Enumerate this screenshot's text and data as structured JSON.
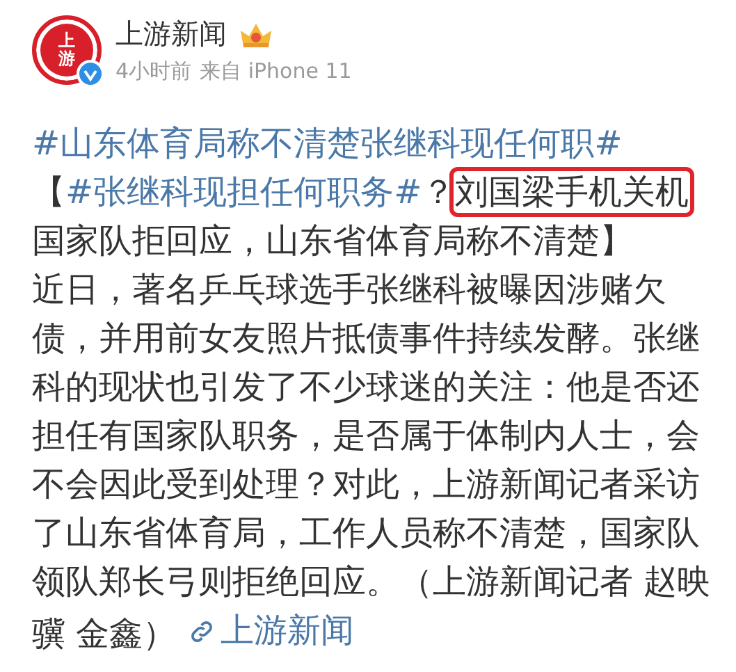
{
  "author": {
    "avatar_text": "上游",
    "name": "上游新闻",
    "verified": true,
    "time": "4小时前",
    "source": "来自 iPhone 11"
  },
  "headline": [
    {
      "kind": "hashtag",
      "text": "#山东体育局称不清楚张继科现任何职#"
    },
    {
      "kind": "text",
      "text": "【"
    },
    {
      "kind": "hashtag",
      "text": "#张继科现担任何职务#"
    },
    {
      "kind": "text",
      "text": "？"
    },
    {
      "kind": "highlight",
      "text": "刘国梁手机关机"
    },
    {
      "kind": "text",
      "text": "国家队拒回应，山东省体育局称不清楚】"
    }
  ],
  "body": [
    {
      "kind": "text",
      "text": "近日，著名乒乓球选手张继科被曝因涉赌欠债，并用前女友照片抵债事件持续发酵。张继科的现状也引发了不少球迷的关注：他是否还担任有国家队职务，是否属于体制内人士，会不会因此受到处理？对此，上游新闻记者采访了山东省体育局，工作人员称不清楚，国家队领队郑长弓则拒绝回应。（上游新闻记者 赵映骥 金鑫）"
    },
    {
      "kind": "link",
      "text": "上游新闻"
    }
  ]
}
